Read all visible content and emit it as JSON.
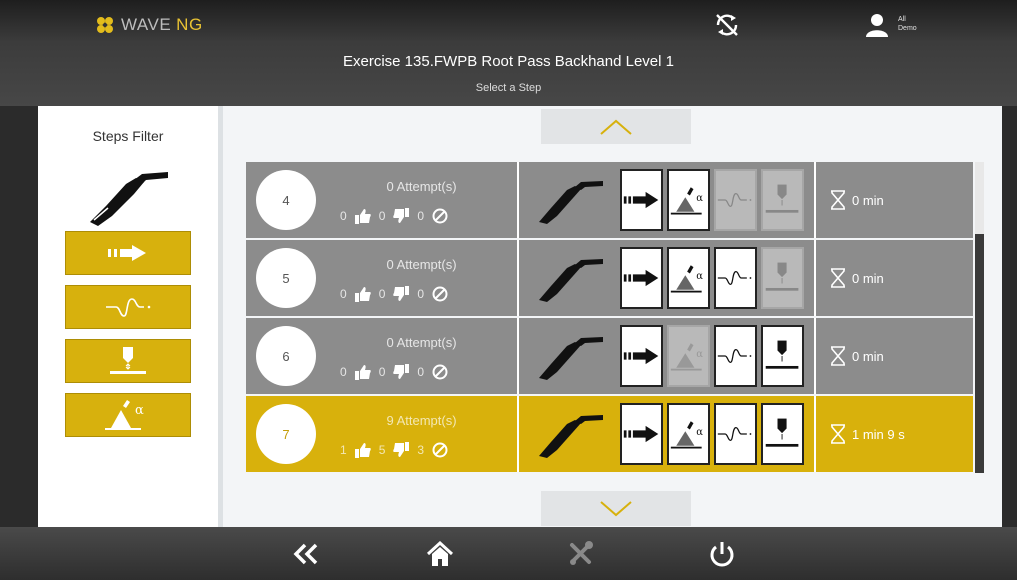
{
  "header": {
    "brand_wave": "WAVE",
    "brand_ng": "NG",
    "user_line1": "All",
    "user_line2": "Demo",
    "title": "Exercise 135.FWPB Root Pass Backhand Level 1",
    "subtitle": "Select a Step"
  },
  "filter": {
    "title": "Steps Filter",
    "buttons": [
      "arrow-speed-icon",
      "wave-signal-icon",
      "stickout-icon",
      "angle-icon"
    ]
  },
  "rows": [
    {
      "number": "4",
      "attempts": "0 Attempt(s)",
      "success": "0",
      "fail": "0",
      "cancel": "0",
      "time": "0 min",
      "state": "normal",
      "tiles": [
        "on",
        "on",
        "dim",
        "dim"
      ]
    },
    {
      "number": "5",
      "attempts": "0 Attempt(s)",
      "success": "0",
      "fail": "0",
      "cancel": "0",
      "time": "0 min",
      "state": "normal",
      "tiles": [
        "on",
        "on",
        "on",
        "dim"
      ]
    },
    {
      "number": "6",
      "attempts": "0 Attempt(s)",
      "success": "0",
      "fail": "0",
      "cancel": "0",
      "time": "0 min",
      "state": "normal",
      "tiles": [
        "on",
        "dim",
        "on",
        "on"
      ]
    },
    {
      "number": "7",
      "attempts": "9 Attempt(s)",
      "success": "1",
      "fail": "5",
      "cancel": "3",
      "time": "1 min 9 s",
      "state": "selected",
      "tiles": [
        "on",
        "on",
        "on",
        "on"
      ]
    }
  ],
  "colors": {
    "accent": "#d7b10d",
    "row_bg": "#8c8c8c",
    "row_selected": "#d8b10c",
    "attempt_text_normal": "#e6e6e6",
    "attempt_text_selected": "#f3e7b3"
  },
  "footer": {
    "icons": [
      "back-double-chevron-icon",
      "home-icon",
      "tools-icon",
      "power-icon"
    ]
  }
}
